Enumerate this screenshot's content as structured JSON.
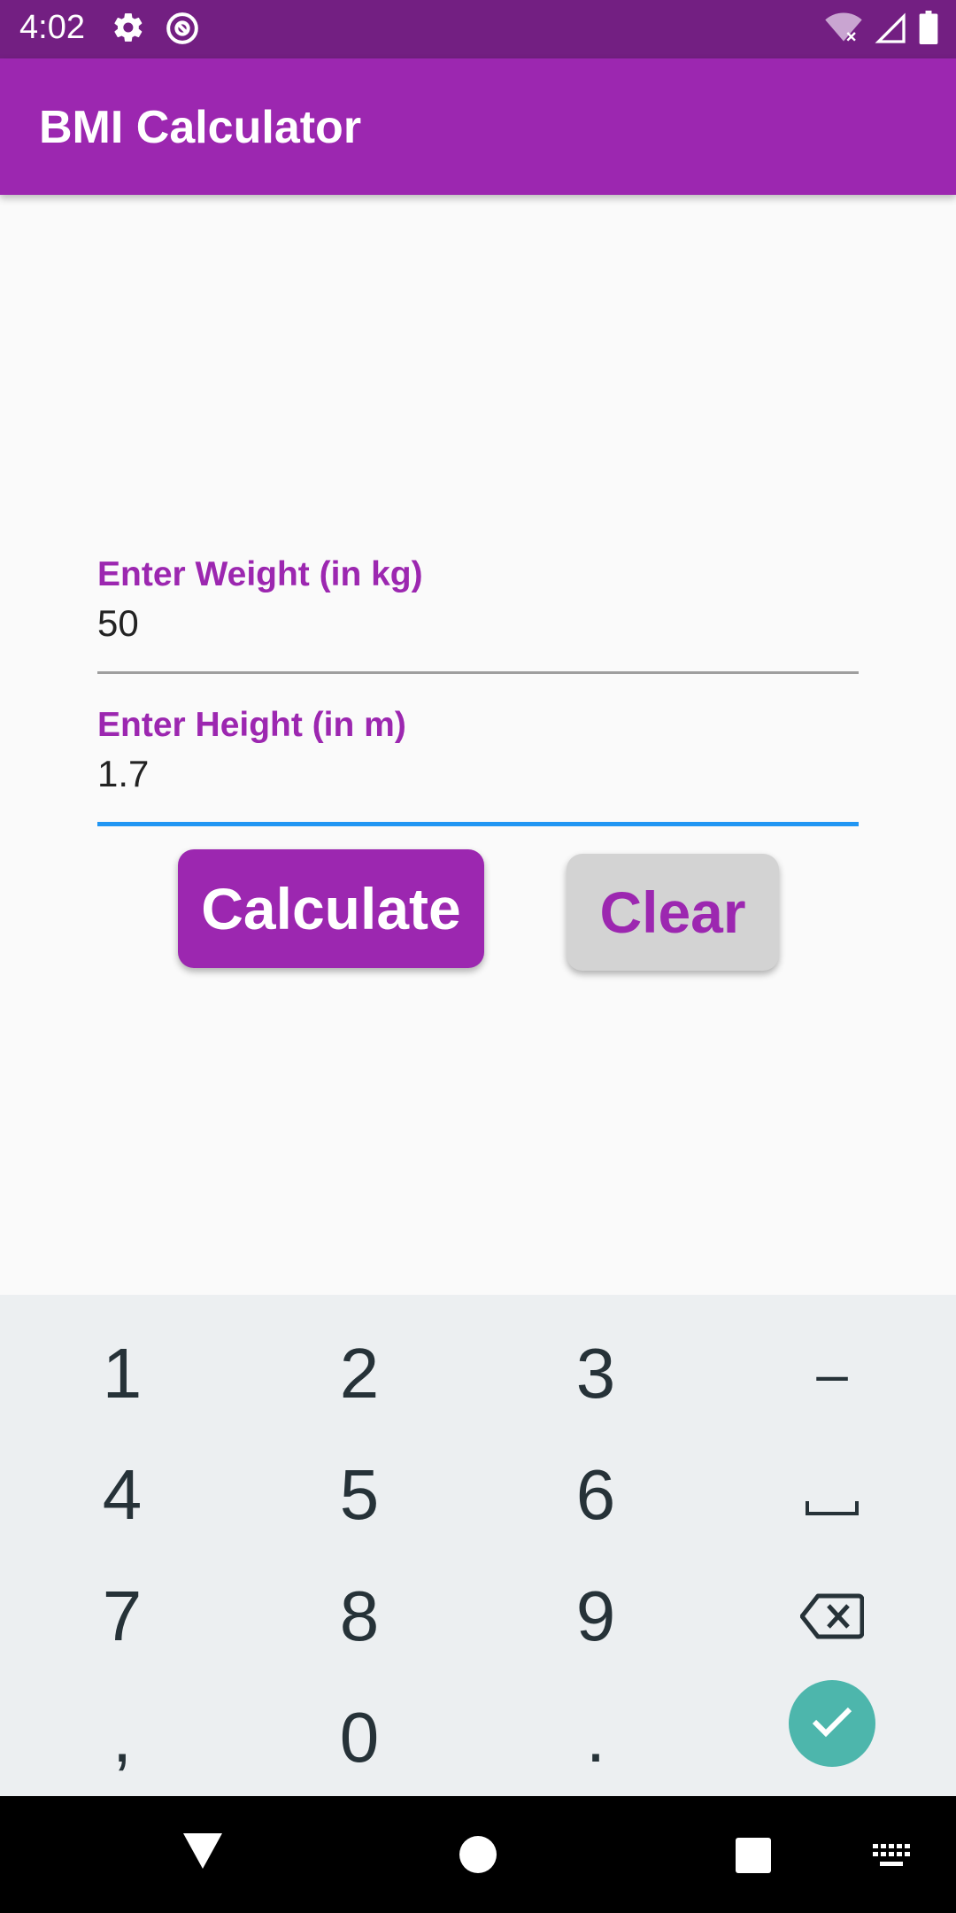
{
  "status_bar": {
    "time": "4:02",
    "icons": [
      "settings-icon",
      "at-sign-icon",
      "wifi-off-icon",
      "signal-icon",
      "battery-icon"
    ]
  },
  "app_bar": {
    "title": "BMI Calculator"
  },
  "form": {
    "weight": {
      "label": "Enter Weight (in kg)",
      "value": "50"
    },
    "height": {
      "label": "Enter Height (in m)",
      "value": "1.7"
    }
  },
  "buttons": {
    "calculate": "Calculate",
    "clear": "Clear"
  },
  "keyboard": {
    "rows": [
      [
        "1",
        "2",
        "3",
        "–"
      ],
      [
        "4",
        "5",
        "6",
        "space"
      ],
      [
        "7",
        "8",
        "9",
        "backspace"
      ],
      [
        ",",
        "0",
        ".",
        "done"
      ]
    ],
    "key_labels": {
      "k1": "1",
      "k2": "2",
      "k3": "3",
      "minus": "–",
      "k4": "4",
      "k5": "5",
      "k6": "6",
      "k7": "7",
      "k8": "8",
      "k9": "9",
      "comma": ",",
      "k0": "0",
      "period": "."
    }
  },
  "nav_bar": {
    "icons": [
      "back-icon",
      "home-icon",
      "recents-icon",
      "keyboard-switch-icon"
    ]
  },
  "colors": {
    "primary": "#9c27b0",
    "status_bar": "#731f82",
    "focus_underline": "#2196f3",
    "done_key": "#4db6ac"
  }
}
